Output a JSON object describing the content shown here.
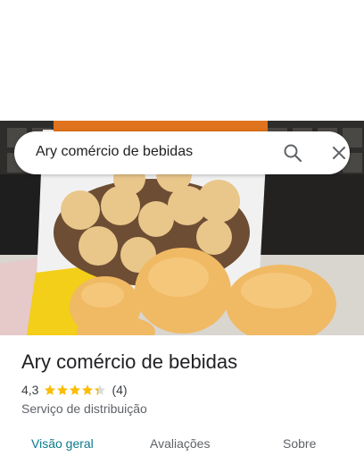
{
  "search": {
    "query": "Ary comércio de bebidas"
  },
  "place": {
    "name": "Ary comércio de bebidas",
    "rating": "4,3",
    "stars": 4.3,
    "review_count": "(4)",
    "category": "Serviço de distribuição"
  },
  "tabs": [
    {
      "label": "Visão geral",
      "active": true
    },
    {
      "label": "Avaliações",
      "active": false
    },
    {
      "label": "Sobre",
      "active": false
    }
  ],
  "colors": {
    "accent": "#0b7a8a",
    "star": "#fbbc04"
  },
  "icons": [
    "search-icon",
    "close-icon",
    "star-icon"
  ]
}
